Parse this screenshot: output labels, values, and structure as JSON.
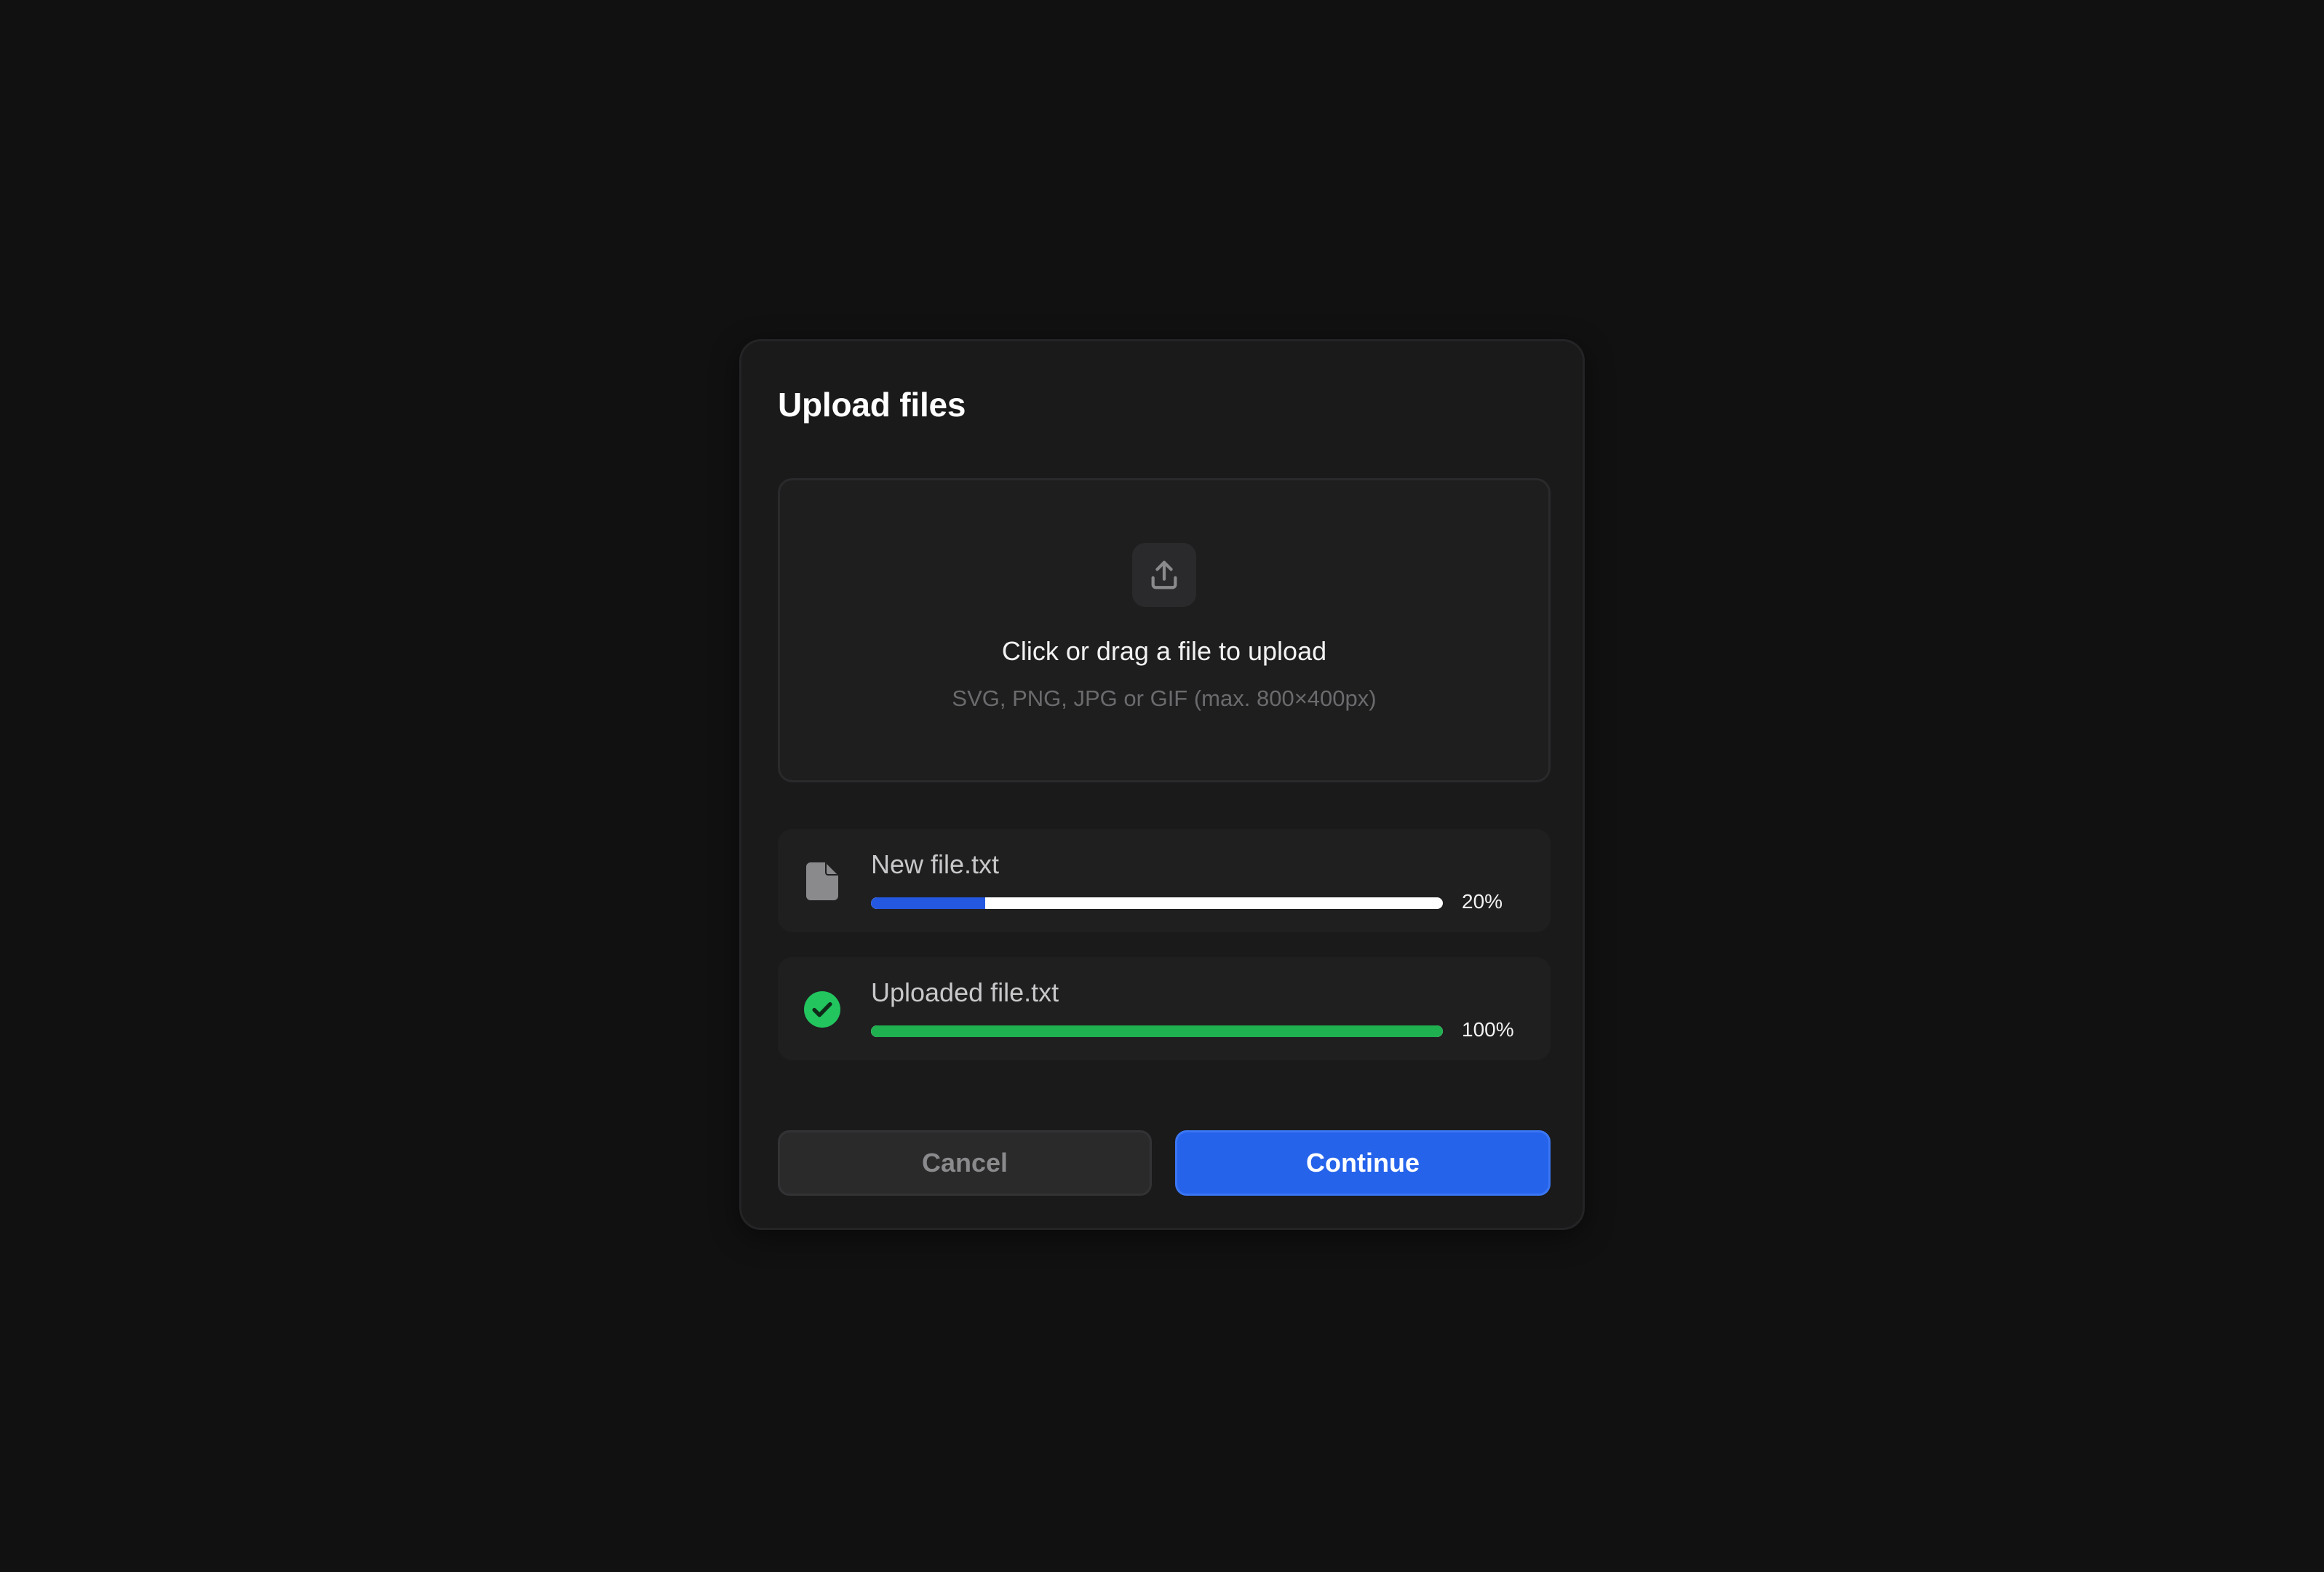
{
  "dialog": {
    "title": "Upload files"
  },
  "dropzone": {
    "icon": "upload-icon",
    "title": "Click or drag a file to upload",
    "subtitle": "SVG, PNG, JPG or GIF (max. 800×400px)"
  },
  "files": [
    {
      "name": "New file.txt",
      "icon": "file-icon",
      "progress": 0.2,
      "progress_label": "20%",
      "bar_color": "#2458e0",
      "status": "uploading"
    },
    {
      "name": "Uploaded file.txt",
      "icon": "check-circle-icon",
      "progress": 1.0,
      "progress_label": "100%",
      "bar_color": "#1fb04f",
      "status": "complete"
    }
  ],
  "actions": {
    "cancel_label": "Cancel",
    "continue_label": "Continue"
  },
  "colors": {
    "accent": "#2563eb",
    "success": "#22c55e",
    "background": "#111111",
    "panel": "#1a1a1b"
  }
}
